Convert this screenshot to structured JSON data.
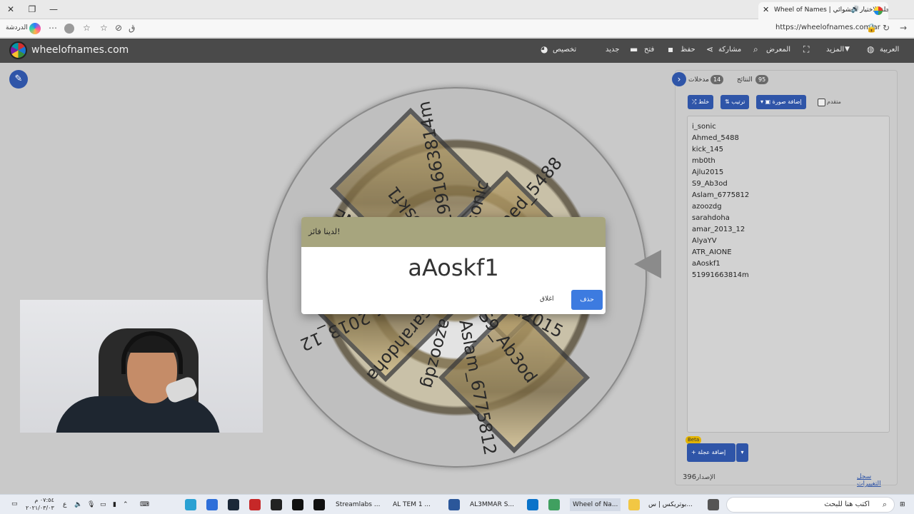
{
  "browser": {
    "tab_title": "Wheel of Names | عجلة الاختيار العشوائي",
    "url": "https://wheelofnames.com/ar",
    "reward_label": "الدردشة"
  },
  "app": {
    "site_name": "wheelofnames.com",
    "menu": {
      "language": "العربية",
      "more": "المزيد",
      "gallery": "المعرض",
      "share": "مشاركة",
      "save": "حفظ",
      "open": "فتح",
      "new": "جديد",
      "customize": "تخصيص"
    }
  },
  "wheel": {
    "labels": [
      "i_sonic",
      "Ahmed_5488",
      "kick_145",
      "mb0th",
      "Ajlu2015",
      "S9_Ab3od",
      "Aslam_6775812",
      "azoozdg",
      "sarahdoha",
      "amar_2013_12",
      "AlyaYV",
      "ATR_AIONE",
      "aAoskf1",
      "51991663814m"
    ]
  },
  "panel": {
    "entries_tab": "مدخلات",
    "entries_count": "14",
    "results_tab": "النتائج",
    "results_count": "95",
    "shuffle": "خلط",
    "sort": "ترتيب",
    "add_image": "إضافة صورة",
    "advanced": "متقدم",
    "entries": [
      "i_sonic",
      "Ahmed_5488",
      "kick_145",
      "mb0th",
      "Ajlu2015",
      "S9_Ab3od",
      "Aslam_6775812",
      "azoozdg",
      "sarahdoha",
      "amar_2013_12",
      "AlyaYV",
      "ATR_AIONE",
      "aAoskf1",
      "51991663814m"
    ],
    "add_wheel": "إضافة عجلة",
    "beta": "Beta",
    "version_label": "الإصدار",
    "version": "396",
    "history": "سجل التغييرات"
  },
  "dialog": {
    "title": "لدينا فائز!",
    "winner": "aAoskf1",
    "delete": "حذف",
    "close": "اغلاق"
  },
  "taskbar": {
    "search_placeholder": "اكتب هنا للبحث",
    "items": [
      "بوتريكس | س...",
      "Wheel of Na...",
      "AL3MMAR S...",
      "AL TEM 1 ...",
      "Streamlabs ..."
    ],
    "time": "٠٧:٥٤ م",
    "date": "٢٠٢١/٠٣/٠٣",
    "lang": "ع"
  }
}
